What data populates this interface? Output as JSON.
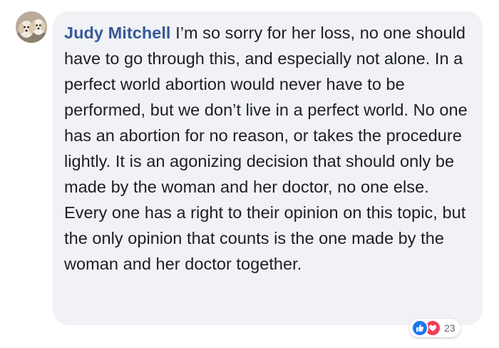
{
  "comment": {
    "author": "Judy Mitchell",
    "text": "I’m so sorry for her loss, no one should have to go through this, and especially not alone. In a perfect world abortion would never have to be performed, but we don’t live in a perfect world. No one has an abortion for no reason, or takes the procedure lightly. It is an agonizing decision that should only be made by the woman and her doctor, no one else. Every one has a right to their opinion on this topic, but the only opinion that counts is the one made by the woman and her doctor together."
  },
  "reactions": {
    "types": [
      "like-icon",
      "love-icon"
    ],
    "count": "23"
  },
  "colors": {
    "author_link": "#385898",
    "bubble_bg": "#f0f2f5",
    "like": "#1877f2",
    "love": "#f33e58"
  }
}
